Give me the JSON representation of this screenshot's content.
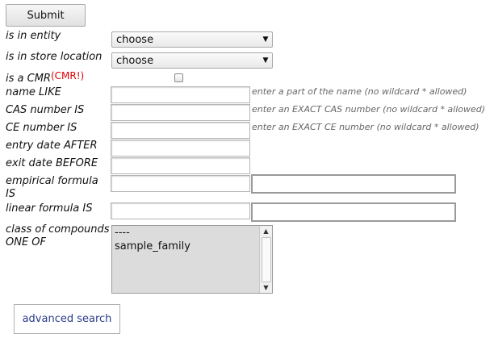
{
  "form": {
    "submit_label": "Submit",
    "entity": {
      "label": "is in entity",
      "selected": "choose"
    },
    "store_location": {
      "label": "is in store location",
      "selected": "choose"
    },
    "cmr": {
      "label": "is a CMR",
      "tag": "(CMR!)",
      "checked": false
    },
    "name": {
      "label": "name LIKE",
      "value": "",
      "hint": "enter a part of the name (no wildcard * allowed)"
    },
    "cas": {
      "label": "CAS number IS",
      "value": "",
      "hint": "enter an EXACT CAS number (no wildcard * allowed)"
    },
    "ce": {
      "label": "CE number IS",
      "value": "",
      "hint": "enter an EXACT CE number (no wildcard * allowed)"
    },
    "entry_date": {
      "label": "entry date AFTER",
      "value": ""
    },
    "exit_date": {
      "label": "exit date BEFORE",
      "value": ""
    },
    "empirical_formula": {
      "label_line1": "empirical formula",
      "label_line2": "IS",
      "value": "",
      "extra_value": ""
    },
    "linear_formula": {
      "label": "linear formula IS",
      "value": "",
      "extra_value": ""
    },
    "compound_class": {
      "label_line1": "class of compounds",
      "label_line2": "ONE OF",
      "options": [
        "----",
        "sample_family"
      ]
    },
    "advanced_search_label": "advanced search"
  }
}
